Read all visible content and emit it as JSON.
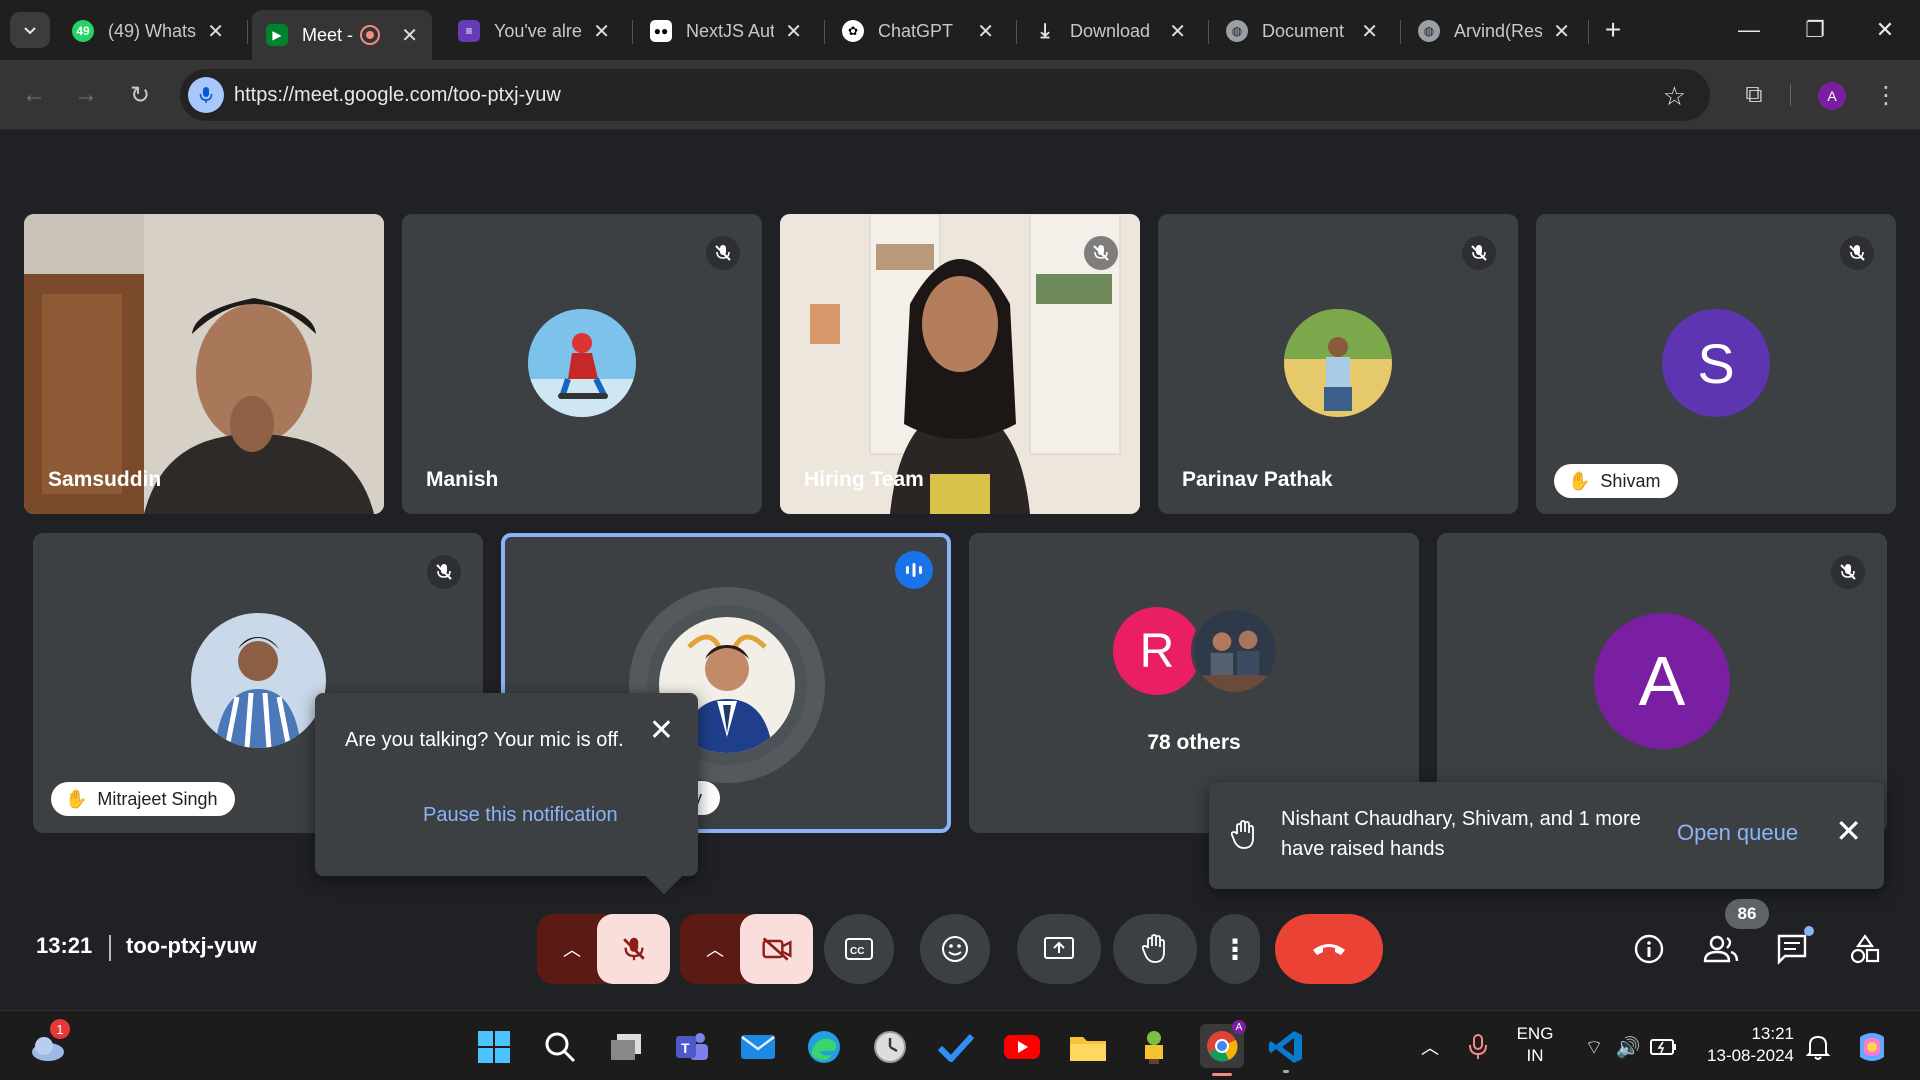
{
  "browser": {
    "tabs": [
      {
        "title": "(49) Whats",
        "favicon": "whatsapp-icon",
        "badge": "49"
      },
      {
        "title": "Meet -",
        "favicon": "google-meet-icon",
        "active": true
      },
      {
        "title": "You've alre",
        "favicon": "forms-icon"
      },
      {
        "title": "NextJS Aut",
        "favicon": "medium-icon"
      },
      {
        "title": "ChatGPT",
        "favicon": "chatgpt-icon"
      },
      {
        "title": "Download",
        "favicon": "download-icon"
      },
      {
        "title": "Document",
        "favicon": "globe-icon"
      },
      {
        "title": "Arvind(Res",
        "favicon": "globe-icon"
      }
    ],
    "url": "https://meet.google.com/too-ptxj-yuw",
    "profile_initial": "A"
  },
  "participants": {
    "top_row": [
      {
        "name": "Samsuddin",
        "kind": "video"
      },
      {
        "name": "Manish",
        "kind": "avatar",
        "muted": true
      },
      {
        "name": "Hiring Team",
        "kind": "video",
        "muted": true
      },
      {
        "name": "Parinav Pathak",
        "kind": "avatar",
        "muted": true
      },
      {
        "name": "Shivam",
        "kind": "initial",
        "initial": "S",
        "color": "#5e35b1",
        "muted": true,
        "hand_raised": true
      }
    ],
    "bottom_row": [
      {
        "name": "Mitrajeet Singh",
        "kind": "avatar",
        "muted": true,
        "hand_raised": true
      },
      {
        "name": "ary",
        "kind": "avatar",
        "speaking": true
      },
      {
        "name": "78 others",
        "kind": "group",
        "initial": "R",
        "color": "#e91e63"
      },
      {
        "name": "",
        "kind": "initial",
        "initial": "A",
        "color": "#7b1fa2",
        "muted": true
      }
    ]
  },
  "mic_tooltip": {
    "message": "Are you talking? Your mic is off.",
    "action": "Pause this notification"
  },
  "hands_toast": {
    "message": "Nishant Chaudhary, Shivam, and 1 more have raised hands",
    "action": "Open queue"
  },
  "meeting": {
    "time": "13:21",
    "code": "too-ptxj-yuw",
    "people_count": "86"
  },
  "colors": {
    "stage_bg": "#202124",
    "tile_bg": "#3c4043",
    "accent_blue": "#8ab4f8",
    "end_call": "#ea4335",
    "muted_red_bg": "#f9dedc"
  },
  "taskbar": {
    "weather_badge": "1",
    "lang_top": "ENG",
    "lang_bottom": "IN",
    "clock_time": "13:21",
    "clock_date": "13-08-2024"
  }
}
